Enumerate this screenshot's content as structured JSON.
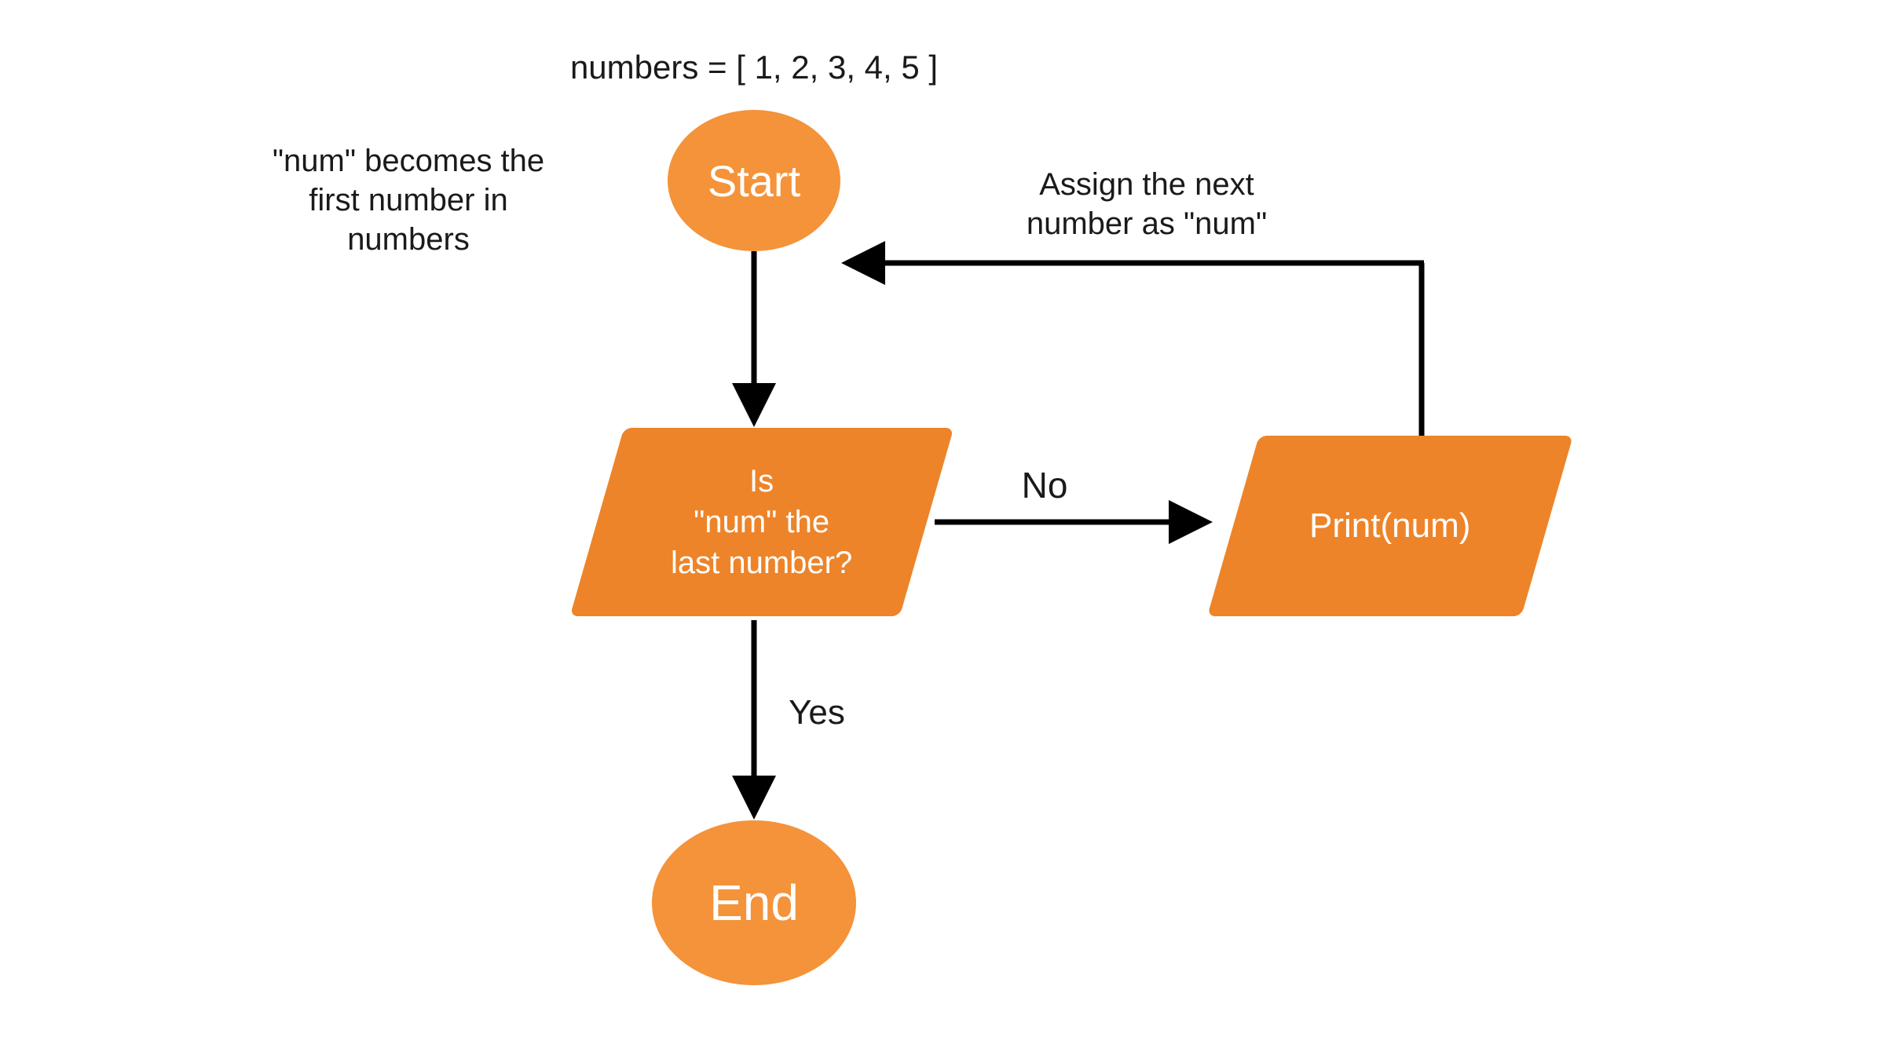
{
  "title_top": "numbers = [ 1, 2, 3, 4, 5 ]",
  "annotation_left": "\"num\" becomes the\nfirst number in\nnumbers",
  "annotation_right": "Assign the next\nnumber as \"num\"",
  "start_label": "Start",
  "decision_line1": "Is",
  "decision_line2": "\"num\" the",
  "decision_line3": "last number?",
  "print_label": "Print(num)",
  "end_label": "End",
  "edge_no": "No",
  "edge_yes": "Yes",
  "colors": {
    "shape_light": "#f4933a",
    "shape_dark": "#ed8429",
    "text_dark": "#1a1a1a",
    "arrow": "#000000"
  }
}
